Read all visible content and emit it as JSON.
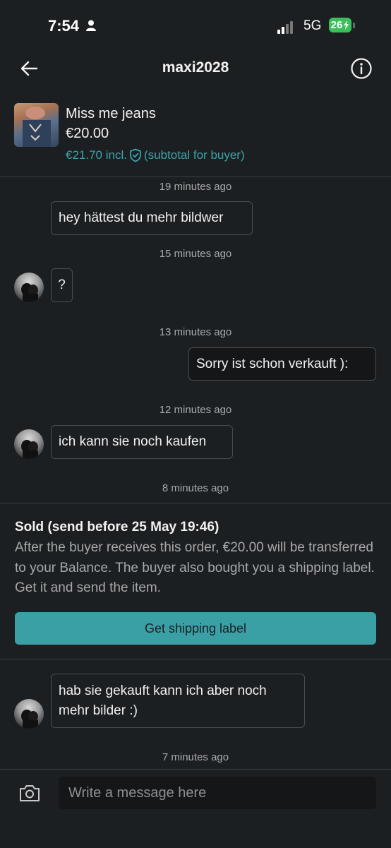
{
  "status_bar": {
    "time": "7:54",
    "network": "5G",
    "battery": "26"
  },
  "header": {
    "title": "maxi2028"
  },
  "item": {
    "name": "Miss me jeans",
    "price": "€20.00",
    "incl_price": "€21.70 incl.",
    "incl_note": "(subtotal for buyer)"
  },
  "messages": [
    {
      "timestamp": "19 minutes ago",
      "text": "hey hättest du mehr bildwer",
      "side": "incoming"
    },
    {
      "timestamp": "15 minutes ago",
      "text": "?",
      "side": "incoming"
    },
    {
      "timestamp": "13 minutes ago",
      "text": "Sorry ist schon verkauft ):",
      "side": "outgoing"
    },
    {
      "timestamp": "12 minutes ago",
      "text": "ich kann sie noch kaufen",
      "side": "incoming"
    },
    {
      "timestamp": "8 minutes ago"
    }
  ],
  "sold": {
    "title": "Sold (send before 25 May 19:46)",
    "body": "After the buyer receives this order, €20.00 will be transferred to your Balance. The buyer also bought you a shipping label. Get it and send the item.",
    "button_label": "Get shipping label"
  },
  "last_message": {
    "text": "hab sie gekauft kann ich aber noch mehr bilder :)",
    "timestamp": "7 minutes ago"
  },
  "composer": {
    "placeholder": "Write a message here"
  },
  "colors": {
    "accent": "#3aa0a6",
    "link": "#3fa2ab",
    "background": "#1c1f21",
    "battery": "#39c05a"
  }
}
